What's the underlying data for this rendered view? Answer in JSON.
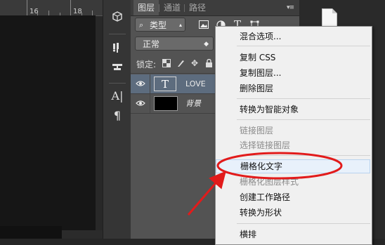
{
  "ruler": {
    "marks": [
      "16",
      "18"
    ]
  },
  "layers_panel": {
    "tabs": [
      "图层",
      "通道",
      "路径"
    ],
    "filter_kind_label": "类型",
    "blend_mode": "正常",
    "lock_label": "锁定:",
    "layers": [
      {
        "name": "LOVE",
        "thumb_text": "T",
        "type": "text",
        "selected": true
      },
      {
        "name": "背景",
        "type": "background",
        "selected": false
      }
    ]
  },
  "context_menu": {
    "items": [
      {
        "label": "混合选项...",
        "enabled": true
      },
      {
        "label": "复制 CSS",
        "enabled": true
      },
      {
        "label": "复制图层...",
        "enabled": true
      },
      {
        "label": "删除图层",
        "enabled": true
      },
      {
        "label": "转换为智能对象",
        "enabled": true
      },
      {
        "label": "链接图层",
        "enabled": false
      },
      {
        "label": "选择链接图层",
        "enabled": false
      },
      {
        "label": "栅格化文字",
        "enabled": true,
        "highlighted": true
      },
      {
        "label": "栅格化图层样式",
        "enabled": false
      },
      {
        "label": "创建工作路径",
        "enabled": true
      },
      {
        "label": "转换为形状",
        "enabled": true
      },
      {
        "label": "横排",
        "enabled": true
      }
    ]
  },
  "colors": {
    "annotation": "#e21b1b",
    "selected_layer": "#5d6c7e",
    "panel": "#535353",
    "menu_bg": "#f0f0f0"
  }
}
